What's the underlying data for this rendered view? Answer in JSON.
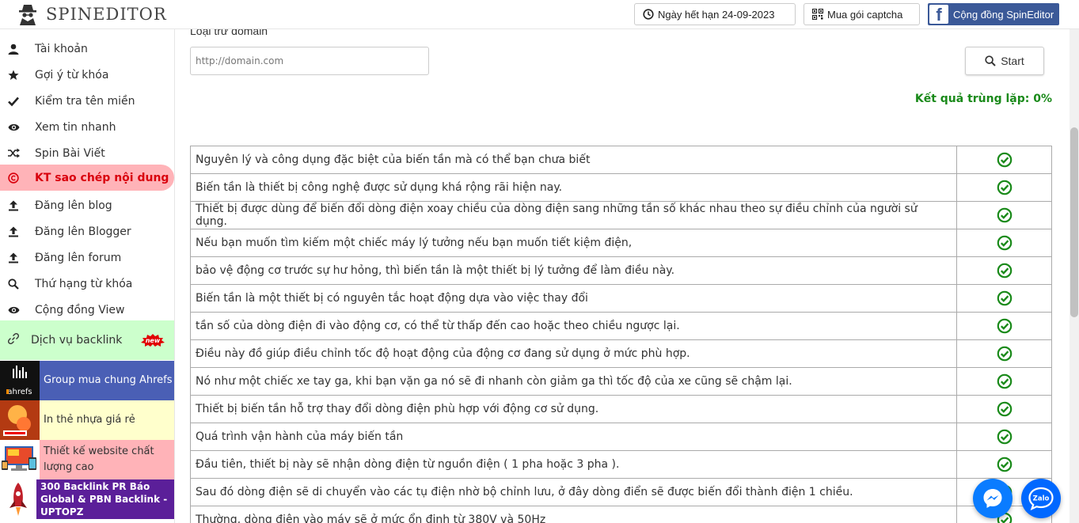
{
  "header": {
    "logo_text": "SPINEDITOR",
    "expiry_label": "Ngày hết hạn 24-09-2023",
    "captcha_label": "Mua gói captcha",
    "community_label": "Cộng đồng SpinEditor"
  },
  "sidebar": {
    "items": [
      {
        "label": "Tài khoản",
        "icon": "user-icon"
      },
      {
        "label": "Gợi ý từ khóa",
        "icon": "star-icon"
      },
      {
        "label": "Kiểm tra tên miền",
        "icon": "check-icon"
      },
      {
        "label": "Xem tin nhanh",
        "icon": "eye-icon"
      },
      {
        "label": "Spin Bài Viết",
        "icon": "shuffle-icon"
      },
      {
        "label": "KT sao chép nội dung",
        "icon": "copyright-icon",
        "active": true
      },
      {
        "label": "Đăng lên blog",
        "icon": "upload-icon"
      },
      {
        "label": "Đăng lên Blogger",
        "icon": "upload-icon"
      },
      {
        "label": "Đăng lên forum",
        "icon": "upload-icon"
      },
      {
        "label": "Thứ hạng từ khóa",
        "icon": "search-icon"
      },
      {
        "label": "Cộng đồng View",
        "icon": "eye-icon"
      }
    ],
    "backlink": {
      "label": "Dịch vụ backlink",
      "badge": "new"
    },
    "promos": [
      {
        "label": "Group mua chung Ahrefs",
        "thumb_text": "ahrefs",
        "bg": "#4a5fb5",
        "color": "#ffffff"
      },
      {
        "label": "In thẻ nhựa giá rẻ",
        "bg": "#ffffcc",
        "color": "#333333"
      },
      {
        "label": "Thiết kế website chất lượng cao",
        "bg": "#ffb3b8",
        "color": "#333333"
      },
      {
        "label": "300 Backlink PR Báo Global & PBN Backlink - UPTOPZ",
        "bg": "#5b1f99",
        "color": "#ffffff"
      }
    ]
  },
  "main": {
    "exclude_label": "Loại trừ domain",
    "domain_placeholder": "http://domain.com",
    "start_label": "Start",
    "result_text": "Kết quả trùng lặp: 0%",
    "sentences": [
      "Nguyên lý và công dụng đặc biệt của biến tần mà có thể bạn chưa biết",
      "Biến tần là thiết bị công nghệ được sử dụng khá rộng rãi hiện nay.",
      "Thiết bị được dùng để biến đổi dòng điện xoay chiều của dòng điện sang những tần số khác nhau theo sự điều chỉnh của người sử dụng.",
      "Nếu bạn muốn tìm kiếm một chiếc máy lý tưởng nếu bạn muốn tiết kiệm điện,",
      "bảo vệ động cơ trước sự hư hỏng, thì biến tần là một thiết bị lý tưởng để làm điều này.",
      "Biến tần là một thiết bị có nguyên tắc hoạt động dựa vào việc thay đổi",
      "tần số của dòng điện đi vào động cơ, có thể từ thấp đến cao hoặc theo chiều ngược lại.",
      "Điều này đồ giúp điều chỉnh tốc độ hoạt động của động cơ đang sử dụng ở mức phù hợp.",
      "Nó như một chiếc xe tay ga, khi bạn vặn ga nó sẽ đi nhanh còn giảm ga thì tốc độ của xe cũng sẽ chậm lại.",
      "Thiết bị biến tần hỗ trợ thay đổi dòng điện phù hợp với động cơ sử dụng.",
      "Quá trình vận hành của máy biến tần",
      "Đầu tiên, thiết bị này sẽ nhận dòng điện từ nguồn điện ( 1 pha hoặc 3 pha ).",
      "Sau đó dòng điện sẽ di chuyển vào các tụ điện nhờ bộ chỉnh lưu, ở đây dòng điển sẽ được biến đổi thành điện 1 chiều.",
      "Thường, dòng điện vào máy sẽ ở mức ổn định từ 380V và 50Hz"
    ],
    "check_color": "#1a8a1a"
  },
  "chat": {
    "zalo_label": "Zalo"
  }
}
